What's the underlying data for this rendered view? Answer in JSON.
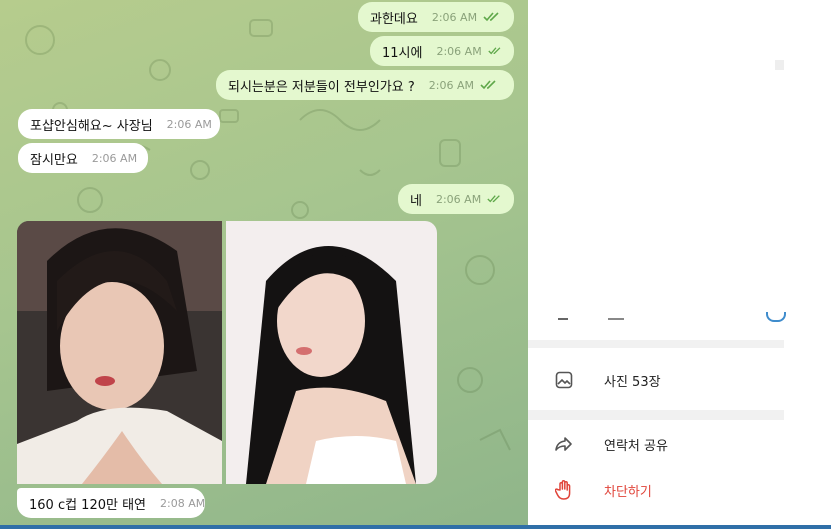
{
  "chat": {
    "messages": [
      {
        "dir": "out",
        "text": "과한데요",
        "time": "2:06 AM"
      },
      {
        "dir": "out",
        "text": "11시에",
        "time": "2:06 AM"
      },
      {
        "dir": "out",
        "text": "되시는분은 저분들이 전부인가요 ?",
        "time": "2:06 AM"
      },
      {
        "dir": "in",
        "text": "포샵안심해요~ 사장님",
        "time": "2:06 AM"
      },
      {
        "dir": "in",
        "text": "잠시만요",
        "time": "2:06 AM"
      },
      {
        "dir": "out",
        "text": "네",
        "time": "2:06 AM"
      }
    ],
    "album_caption": {
      "text": "160 c컵 120만 태연",
      "time": "2:08 AM"
    }
  },
  "info_panel": {
    "items": [
      {
        "icon": "image-icon",
        "label": "사진 53장"
      },
      {
        "icon": "share-arrow-icon",
        "label": "연락처 공유"
      },
      {
        "icon": "hand-stop-icon",
        "label": "차단하기",
        "color": "#e0443a"
      }
    ]
  },
  "colors": {
    "outgoing_bubble": "#e4f8cf",
    "incoming_bubble": "#ffffff",
    "chat_background": "#a6c58f",
    "danger": "#e0443a",
    "checkmarks": "#5fa84a"
  }
}
